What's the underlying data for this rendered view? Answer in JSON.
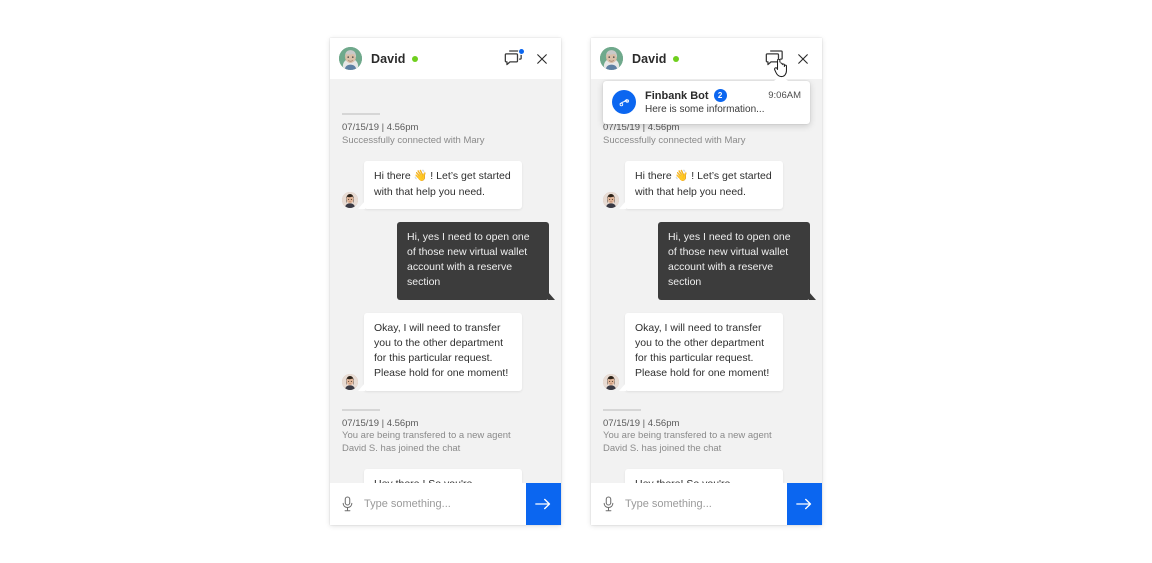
{
  "page": {
    "background": "#ffffff",
    "accent_blue": "#0b66f0",
    "online_green": "#6fcf1e",
    "bubble_dark": "#3c3c3c",
    "chat_bg": "#f2f2f2"
  },
  "panels": [
    {
      "id": "panel-a",
      "header": {
        "name": "David",
        "status": "online",
        "avatar_icon": "avatar-david",
        "chat_list_icon": "chat-bubbles-icon",
        "has_badge": true,
        "close_icon": "close-icon",
        "cursor_visible": false
      },
      "notification": null,
      "body": [
        {
          "kind": "system",
          "time": "07/15/19 | 4.56pm",
          "lines": [
            "Successfully connected with Mary"
          ]
        },
        {
          "kind": "message",
          "direction": "in",
          "avatar_icon": "avatar-mary",
          "text_prefix": "Hi there ",
          "emoji": "👋",
          "text_suffix": " ! Let’s get started with that help you need."
        },
        {
          "kind": "message",
          "direction": "out",
          "text": "Hi, yes I need to open one of those new virtual wallet account with a reserve section"
        },
        {
          "kind": "message",
          "direction": "in",
          "avatar_icon": "avatar-mary",
          "text": "Okay, I will need to transfer you to the other department for this particular request. Please hold for one moment!"
        },
        {
          "kind": "system",
          "time": "07/15/19 | 4.56pm",
          "lines": [
            "You are being transfered to a new agent",
            "David S. has joined the chat"
          ]
        },
        {
          "kind": "message",
          "direction": "in",
          "avatar_icon": "avatar-david-small",
          "text": "Hey there ! So you're interested in a Reserve Virtual Wallet. Is that right?"
        }
      ],
      "composer": {
        "mic_icon": "microphone-icon",
        "placeholder": "Type something...",
        "value": "",
        "send_icon": "arrow-right-icon"
      }
    },
    {
      "id": "panel-b",
      "header": {
        "name": "David",
        "status": "online",
        "avatar_icon": "avatar-david",
        "chat_list_icon": "chat-bubbles-icon",
        "has_badge": false,
        "close_icon": "close-icon",
        "cursor_visible": true
      },
      "notification": {
        "bot_avatar_icon": "finbank-bot-icon",
        "title": "Finbank Bot",
        "badge": "2",
        "time": "9:06AM",
        "preview": "Here is some information..."
      },
      "body": [
        {
          "kind": "system",
          "time": "07/15/19 | 4.56pm",
          "lines": [
            "Successfully connected with Mary"
          ]
        },
        {
          "kind": "message",
          "direction": "in",
          "avatar_icon": "avatar-mary",
          "text_prefix": "Hi there ",
          "emoji": "👋",
          "text_suffix": " ! Let’s get started with that help you need."
        },
        {
          "kind": "message",
          "direction": "out",
          "text": "Hi, yes I need to open one of those new virtual wallet account with a reserve section"
        },
        {
          "kind": "message",
          "direction": "in",
          "avatar_icon": "avatar-mary",
          "text": "Okay, I will need to transfer you to the other department for this particular request. Please hold for one moment!"
        },
        {
          "kind": "system",
          "time": "07/15/19 | 4.56pm",
          "lines": [
            "You are being transfered to a new agent",
            "David S. has joined the chat"
          ]
        },
        {
          "kind": "message",
          "direction": "in",
          "avatar_icon": "avatar-david-small",
          "text": "Hey there! So you're interested in a Reserve Virtual Wallet. Is that right?"
        }
      ],
      "composer": {
        "mic_icon": "microphone-icon",
        "placeholder": "Type something...",
        "value": "",
        "send_icon": "arrow-right-icon"
      }
    }
  ]
}
